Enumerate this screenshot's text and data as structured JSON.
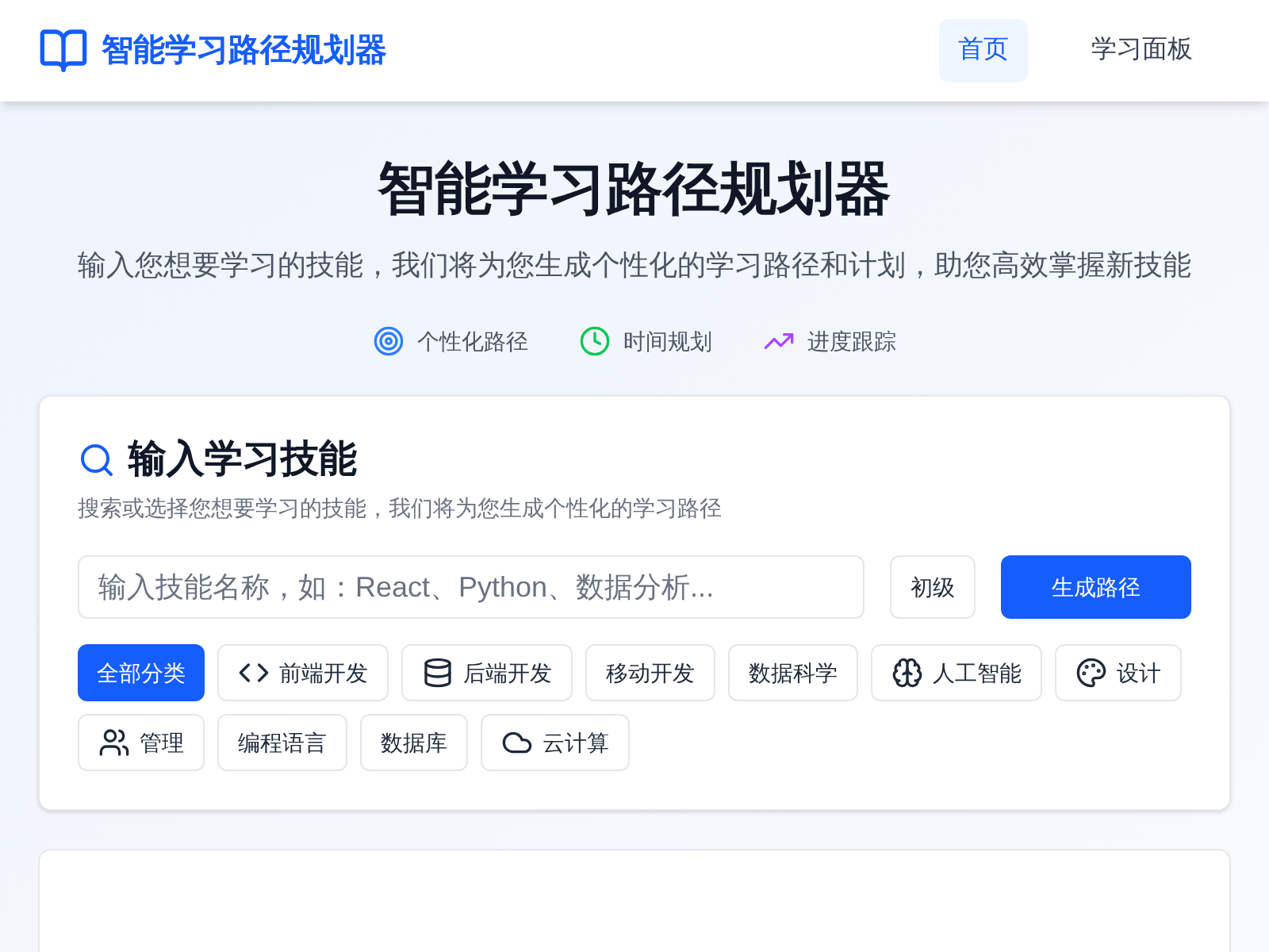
{
  "header": {
    "brand": "智能学习路径规划器",
    "nav": [
      {
        "label": "首页",
        "selected": true
      },
      {
        "label": "学习面板",
        "selected": false
      }
    ]
  },
  "hero": {
    "title": "智能学习路径规划器",
    "subtitle": "输入您想要学习的技能，我们将为您生成个性化的学习路径和计划，助您高效掌握新技能",
    "features": [
      {
        "kind": "target",
        "label": "个性化路径"
      },
      {
        "kind": "clock",
        "label": "时间规划"
      },
      {
        "kind": "trend",
        "label": "进度跟踪"
      }
    ]
  },
  "search_card": {
    "title": "输入学习技能",
    "description": "搜索或选择您想要学习的技能，我们将为您生成个性化的学习路径",
    "input": {
      "placeholder": "输入技能名称，如：React、Python、数据分析..."
    },
    "level": "初级",
    "submit": "生成路径",
    "categories": [
      {
        "label": "全部分类",
        "kind": "plain",
        "selected": true
      },
      {
        "label": "前端开发",
        "kind": "code",
        "selected": false
      },
      {
        "label": "后端开发",
        "kind": "database",
        "selected": false
      },
      {
        "label": "移动开发",
        "kind": "plain",
        "selected": false
      },
      {
        "label": "数据科学",
        "kind": "plain",
        "selected": false
      },
      {
        "label": "人工智能",
        "kind": "brain",
        "selected": false
      },
      {
        "label": "设计",
        "kind": "palette",
        "selected": false
      },
      {
        "label": "管理",
        "kind": "users",
        "selected": false
      },
      {
        "label": "编程语言",
        "kind": "plain",
        "selected": false
      },
      {
        "label": "数据库",
        "kind": "plain",
        "selected": false
      },
      {
        "label": "云计算",
        "kind": "cloud",
        "selected": false
      }
    ]
  }
}
